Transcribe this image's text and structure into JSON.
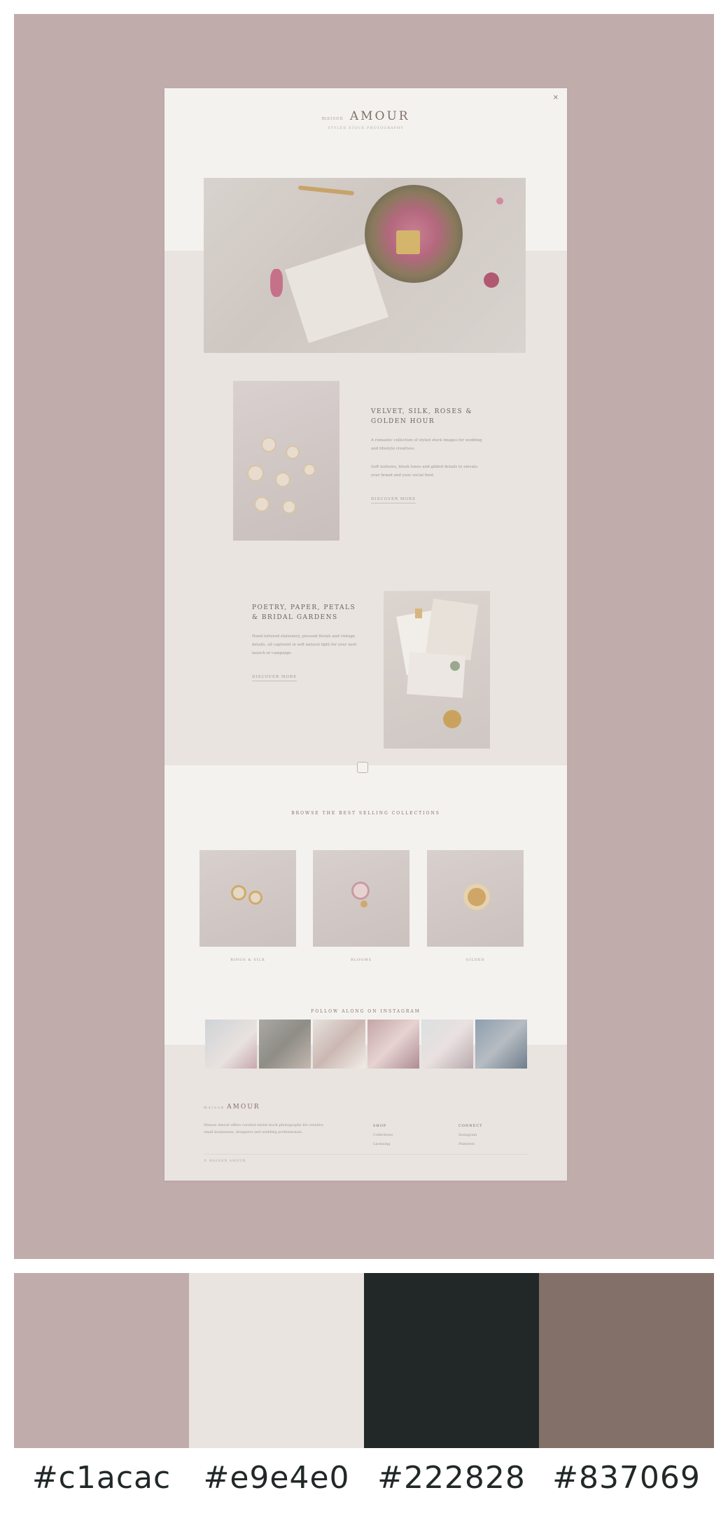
{
  "mockup": {
    "close_label": "×",
    "logo_prefix": "maison",
    "logo": "AMOUR",
    "tagline": "STYLED STOCK PHOTOGRAPHY",
    "feature1": {
      "title": "VELVET, SILK, ROSES & GOLDEN HOUR",
      "body1": "A romantic collection of styled stock images for wedding and lifestyle creatives.",
      "body2": "Soft textures, blush tones and gilded details to elevate your brand and your social feed.",
      "link": "DISCOVER MORE"
    },
    "feature2": {
      "title": "POETRY, PAPER, PETALS & BRIDAL GARDENS",
      "body": "Hand lettered stationery, pressed florals and vintage details, all captured in soft natural light for your next launch or campaign.",
      "link": "DISCOVER MORE"
    },
    "collections_title": "BROWSE THE BEST SELLING COLLECTIONS",
    "collections": [
      {
        "label": "RINGS & SILK"
      },
      {
        "label": "BLOOMS"
      },
      {
        "label": "GILDED"
      }
    ],
    "instagram_title": "FOLLOW ALONG ON INSTAGRAM",
    "footer": {
      "logo_prefix": "maison",
      "logo": "AMOUR",
      "body": "Maison Amour offers curated styled stock photography for creative small businesses, designers and wedding professionals.",
      "col1_head": "SHOP",
      "col1_items": [
        "Collections",
        "Licensing"
      ],
      "col2_head": "CONNECT",
      "col2_items": [
        "Instagram",
        "Pinterest"
      ],
      "copyright": "© MAISON AMOUR"
    }
  },
  "palette": [
    {
      "hex": "#c1acac"
    },
    {
      "hex": "#e9e4e0"
    },
    {
      "hex": "#222828"
    },
    {
      "hex": "#837069"
    }
  ],
  "palette_labels": [
    "#c1acac",
    "#e9e4e0",
    "#222828",
    "#837069"
  ]
}
